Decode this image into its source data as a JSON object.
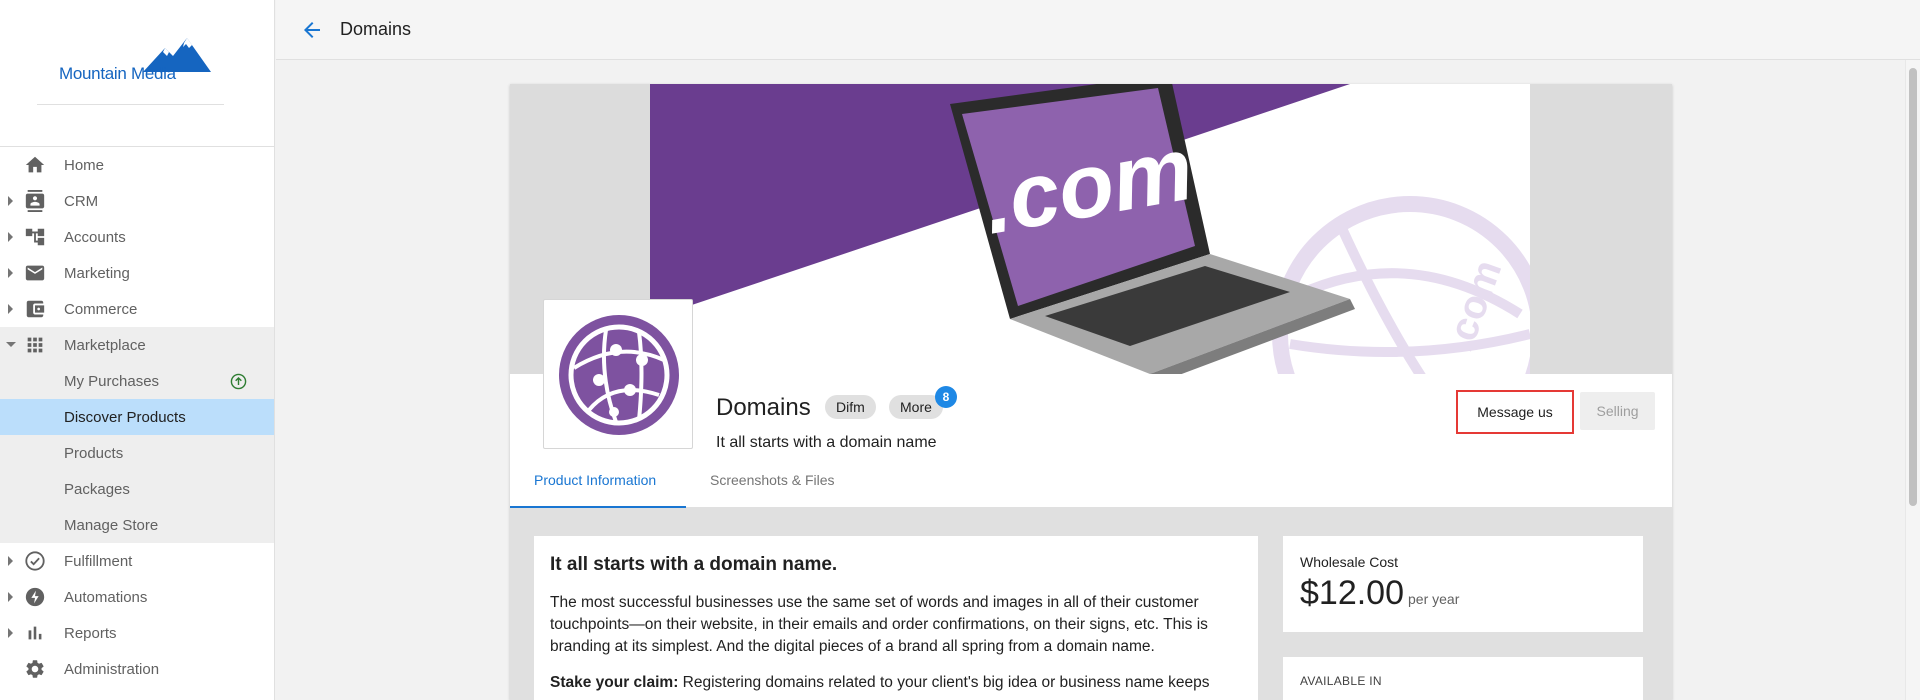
{
  "brand": {
    "name": "Mountain Media",
    "color": "#1565c0"
  },
  "topbar": {
    "title": "Domains",
    "back_icon": "arrow-left-icon"
  },
  "sidebar": {
    "items": [
      {
        "label": "Home",
        "icon": "home-icon",
        "has_caret": false
      },
      {
        "label": "CRM",
        "icon": "contacts-icon",
        "has_caret": true
      },
      {
        "label": "Accounts",
        "icon": "hierarchy-icon",
        "has_caret": true
      },
      {
        "label": "Marketing",
        "icon": "mail-icon",
        "has_caret": true
      },
      {
        "label": "Commerce",
        "icon": "wallet-icon",
        "has_caret": true
      },
      {
        "label": "Marketplace",
        "icon": "apps-grid-icon",
        "has_caret": true,
        "expanded": true
      },
      {
        "label": "Fulfillment",
        "icon": "check-circle-icon",
        "has_caret": true
      },
      {
        "label": "Automations",
        "icon": "bolt-icon",
        "has_caret": true
      },
      {
        "label": "Reports",
        "icon": "bar-chart-icon",
        "has_caret": true
      },
      {
        "label": "Administration",
        "icon": "gear-icon",
        "has_caret": false
      }
    ],
    "marketplace_children": [
      {
        "label": "My Purchases",
        "icon": "arrow-up-circle-icon"
      },
      {
        "label": "Discover Products",
        "active": true
      },
      {
        "label": "Products"
      },
      {
        "label": "Packages"
      },
      {
        "label": "Manage Store"
      }
    ]
  },
  "product": {
    "name": "Domains",
    "tags": [
      "Difm",
      "More"
    ],
    "more_count": "8",
    "tagline": "It all starts with a domain name",
    "actions": {
      "message": "Message us",
      "selling": "Selling"
    },
    "tabs": [
      "Product Information",
      "Screenshots & Files"
    ],
    "active_tab": "Product Information",
    "hero_text": ".com",
    "hero_watermark": ".com"
  },
  "description": {
    "heading": "It all starts with a domain name.",
    "paragraph1": "The most successful businesses use the same set of words and images in all of their customer touchpoints—on their website, in their emails and order confirmations, on their signs, etc. This is branding at its simplest. And the digital pieces of a brand all spring from a domain name.",
    "stake_label": "Stake your claim:",
    "stake_text": " Registering domains related to your client's big idea or business name keeps"
  },
  "pricing": {
    "label": "Wholesale Cost",
    "value": "$12.00",
    "unit": "per year",
    "available_label": "AVAILABLE IN"
  },
  "colors": {
    "accent": "#1976d2",
    "purple": "#6a3d8f",
    "highlight_border": "#e53935",
    "active_nav": "#bbdefb",
    "badge": "#1e88e5",
    "success": "#2e7d32"
  }
}
